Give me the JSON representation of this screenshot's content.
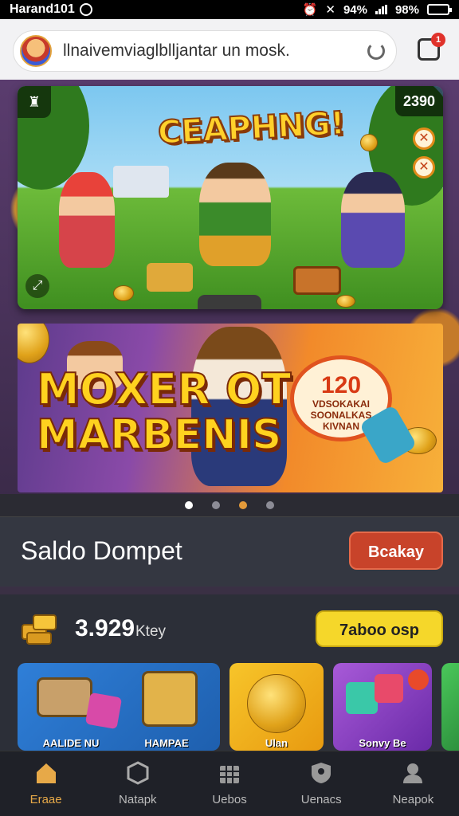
{
  "status_bar": {
    "time_label": "Harand101",
    "wifi_label": "94%",
    "battery_label": "98%"
  },
  "browser": {
    "url": "llnaivemviaglblljantar un mosk.",
    "tabs_badge": "1"
  },
  "banner1": {
    "title": "CEAPHNG!",
    "score": "2390"
  },
  "banner2": {
    "title_line1": "MOXER OT",
    "title_line2": "MARBENIS",
    "bubble_number": "120",
    "bubble_text1": "VDSOKAKAI",
    "bubble_text2": "SOONALKAS",
    "bubble_text3": "KIVNAN"
  },
  "carousel": {
    "count": 4,
    "active_index": 0
  },
  "wallet": {
    "title": "Saldo Dompet",
    "button_label": "Bcakay"
  },
  "balance": {
    "amount": "3.929",
    "unit": "Ktey",
    "button_label": "7aboo osp"
  },
  "cards": [
    {
      "label": "AALIDE NU",
      "color": "#2f7fd8"
    },
    {
      "label": "HAMPAE",
      "color": "#2f7fd8"
    },
    {
      "label": "Ulan",
      "color": "#f2b01e"
    },
    {
      "label": "Sonvy Be",
      "color": "#8a44c8"
    },
    {
      "label": "",
      "color": "#3fb04a"
    }
  ],
  "nav": [
    {
      "label": "Eraae",
      "icon": "home-icon",
      "active": true
    },
    {
      "label": "Natapk",
      "icon": "cube-icon",
      "active": false
    },
    {
      "label": "Uebos",
      "icon": "grid-icon",
      "active": false
    },
    {
      "label": "Uenacs",
      "icon": "shield-user-icon",
      "active": false
    },
    {
      "label": "Neapok",
      "icon": "profile-icon",
      "active": false
    }
  ],
  "colors": {
    "accent": "#e7a948",
    "wallet_button": "#c8432a",
    "balance_button": "#f5d72a"
  }
}
